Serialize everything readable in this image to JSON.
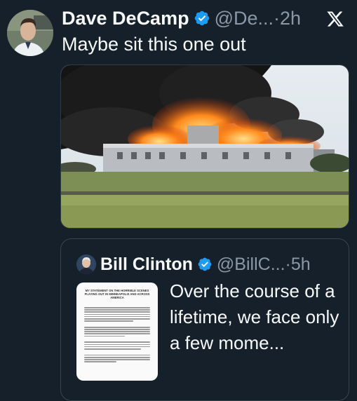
{
  "tweet": {
    "author_name": "Dave DeCamp",
    "handle_time": "@De...·2h",
    "text": "Maybe sit this one out",
    "avatar_icon": "profile-photo",
    "verified_icon": "verified-badge-icon"
  },
  "quote": {
    "author_name": "Bill Clinton",
    "handle_time": "@BillC...·5h",
    "text": "Over the course of a lifetime, we face only a few mome...",
    "document": {
      "title": "MY STATEMENT ON THE HORRIBLE SCENES PLAYING OUT IN MINNEAPOLIS AND ACROSS AMERICA"
    }
  },
  "colors": {
    "background": "#15202b",
    "verified_blue": "#1d9bf0",
    "secondary_text": "#8b98a5"
  }
}
